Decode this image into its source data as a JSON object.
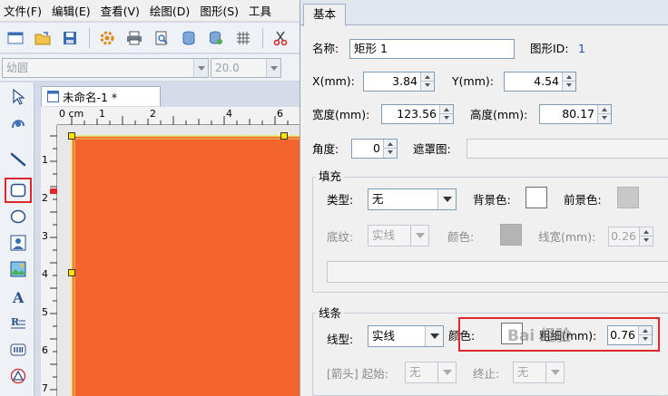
{
  "menubar": {
    "items": [
      "文件(F)",
      "编辑(E)",
      "查看(V)",
      "绘图(D)",
      "图形(S)",
      "工具"
    ]
  },
  "fontbar": {
    "font_name": "幼圆",
    "font_size": "20.0"
  },
  "document": {
    "tab_title": "未命名-1 *",
    "ruler_unit": "0 cm",
    "ruler_top_ticks": [
      "1",
      "2",
      "4",
      "6"
    ],
    "ruler_left_ticks": [
      "1",
      "2",
      "3",
      "4",
      "5",
      "6",
      "7"
    ]
  },
  "panel": {
    "tab": "基本",
    "name_label": "名称:",
    "name_value": "矩形 1",
    "shape_id_label": "图形ID:",
    "shape_id_value": "1",
    "x_label": "X(mm):",
    "x_value": "3.84",
    "y_label": "Y(mm):",
    "y_value": "4.54",
    "width_label": "宽度(mm):",
    "width_value": "123.56",
    "height_label": "高度(mm):",
    "height_value": "80.17",
    "angle_label": "角度:",
    "angle_value": "0",
    "mask_label": "遮罩图:",
    "fill": {
      "title": "填充",
      "type_label": "类型:",
      "type_value": "无",
      "bg_color_label": "背景色:",
      "fg_color_label": "前景色:",
      "texture_label": "底纹:",
      "texture_value": "实线",
      "color_label": "颜色:",
      "line_width_label": "线宽(mm):",
      "line_width_value": "0.26"
    },
    "line": {
      "title": "线条",
      "type_label": "线型:",
      "type_value": "实线",
      "color_label": "颜色:",
      "thickness_label": "粗细(mm):",
      "thickness_value": "0.76",
      "arrow_label": "[箭头] 起始:",
      "arrow_start_value": "无",
      "arrow_end_label": "终止:",
      "arrow_end_value": "无"
    }
  },
  "watermark": "Bai 经验",
  "colors": {
    "accent_red": "#e0262b",
    "shape_fill": "#f4642d",
    "selected_tool_border": "#e0262b"
  }
}
